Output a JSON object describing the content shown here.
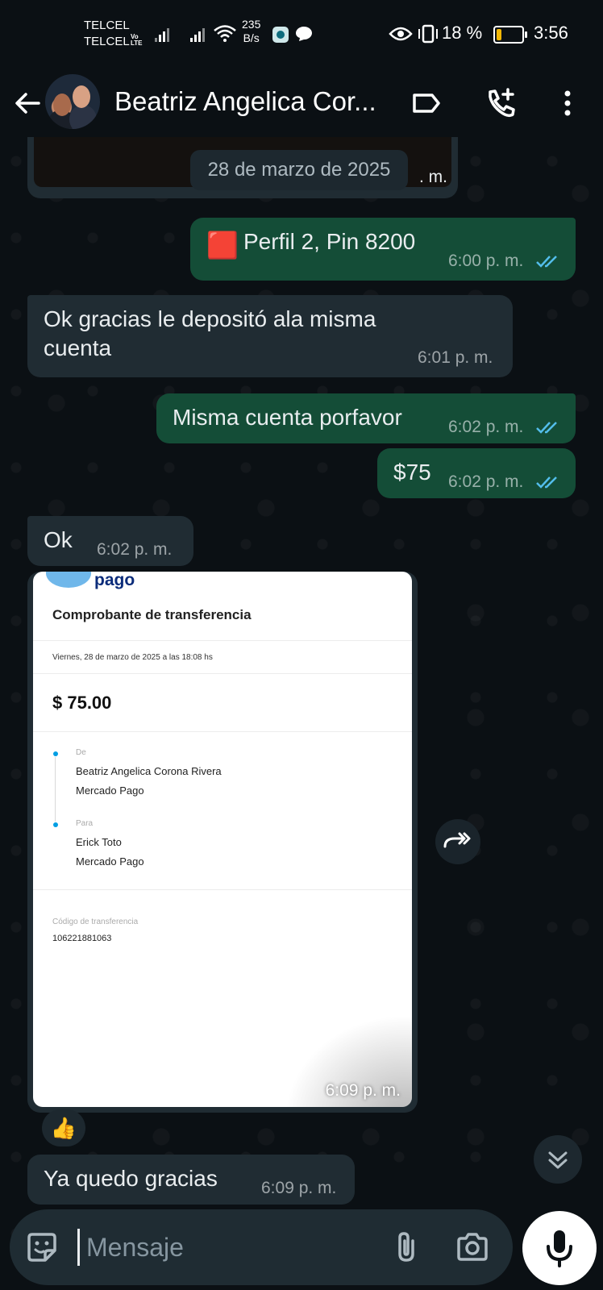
{
  "status_bar": {
    "carrier1": "TELCEL",
    "carrier2": "TELCEL",
    "vo_lte": "Vo LTE",
    "net_speed_value": "235",
    "net_speed_unit": "B/s",
    "battery": "18 %",
    "time": "3:56"
  },
  "header": {
    "contact_name": "Beatriz Angelica Cor..."
  },
  "chat": {
    "date_chip": "28 de marzo de 2025",
    "prev_media_time_fragment": ". m.",
    "messages": [
      {
        "direction": "out",
        "prefix_emoji": "🟥",
        "text": "Perfil 2, Pin 8200",
        "time": "6:00 p. m.",
        "read": true
      },
      {
        "direction": "in",
        "text_line1": "Ok gracias  le depositó ala misma",
        "text_line2": "cuenta",
        "time": "6:01 p. m."
      },
      {
        "direction": "out",
        "text": "Misma cuenta porfavor",
        "time": "6:02 p. m.",
        "read": true
      },
      {
        "direction": "out",
        "text": "$75",
        "time": "6:02 p. m.",
        "read": true
      },
      {
        "direction": "in",
        "text": "Ok",
        "time": "6:02 p. m."
      },
      {
        "direction": "in",
        "type": "image",
        "time": "6:09 p. m."
      },
      {
        "direction": "in",
        "text": "Ya quedo gracias",
        "time": "6:09 p. m."
      }
    ],
    "reaction": "👍"
  },
  "receipt": {
    "logo_text": "pago",
    "title": "Comprobante de transferencia",
    "date": "Viernes, 28 de marzo de 2025 a las 18:08 hs",
    "amount": "$ 75.00",
    "from_label": "De",
    "from_name": "Beatriz Angelica Corona Rivera",
    "from_bank": "Mercado Pago",
    "to_label": "Para",
    "to_name": "Erick Toto",
    "to_bank": "Mercado Pago",
    "code_label": "Código de transferencia",
    "code": "106221881063"
  },
  "input": {
    "placeholder": "Mensaje"
  },
  "colors": {
    "outgoing_bubble": "#144d37",
    "incoming_bubble": "#202c33",
    "tick_read": "#53bdeb",
    "background": "#0b1014"
  }
}
